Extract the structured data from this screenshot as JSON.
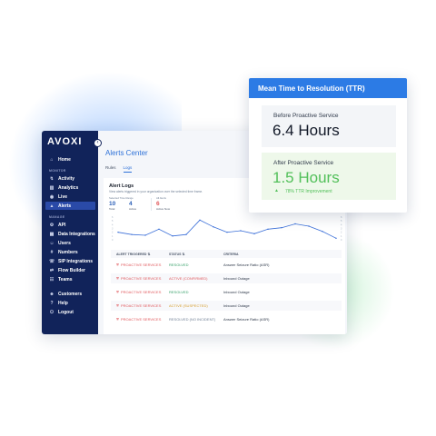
{
  "brand": {
    "logo": "AVOXI",
    "accent": "#2c7be5",
    "sidebar_bg": "#11235a"
  },
  "sidebar": {
    "items_top": [
      {
        "label": "Home",
        "icon": "home-icon",
        "glyph": "⌂"
      }
    ],
    "section_monitor": "MONITOR",
    "items_monitor": [
      {
        "label": "Activity",
        "icon": "activity-icon",
        "glyph": "↯"
      },
      {
        "label": "Analytics",
        "icon": "analytics-icon",
        "glyph": "▥"
      },
      {
        "label": "Live",
        "icon": "live-icon",
        "glyph": "◉"
      },
      {
        "label": "Alerts",
        "icon": "alert-icon",
        "glyph": "▲",
        "active": true
      }
    ],
    "section_manage": "MANAGE",
    "items_manage": [
      {
        "label": "API",
        "icon": "api-icon",
        "glyph": "⚙"
      },
      {
        "label": "Data Integrations",
        "icon": "data-integrations-icon",
        "glyph": "▦"
      },
      {
        "label": "Users",
        "icon": "users-icon",
        "glyph": "☺"
      },
      {
        "label": "Numbers",
        "icon": "numbers-icon",
        "glyph": "#"
      },
      {
        "label": "SIP Integrations",
        "icon": "sip-icon",
        "glyph": "☏"
      },
      {
        "label": "Flow Builder",
        "icon": "flow-builder-icon",
        "glyph": "⇄"
      },
      {
        "label": "Teams",
        "icon": "teams-icon",
        "glyph": "☷"
      }
    ],
    "items_bottom": [
      {
        "label": "Customers",
        "icon": "customers-icon",
        "glyph": "☻"
      },
      {
        "label": "Help",
        "icon": "help-icon",
        "glyph": "?"
      },
      {
        "label": "Logout",
        "icon": "logout-icon",
        "glyph": "⏻"
      }
    ]
  },
  "main": {
    "title": "Alerts Center",
    "tabs": [
      {
        "label": "Rules"
      },
      {
        "label": "Logs",
        "active": true
      }
    ],
    "logs": {
      "title": "Alert Logs",
      "subtitle": "View alerts triggered in your organization over the selected time frame.",
      "stats": [
        {
          "label": "Selected Time Range",
          "value": "10",
          "caption": "Total"
        },
        {
          "label": "",
          "value": "4",
          "caption": "Active"
        },
        {
          "label": "All Alerts",
          "value": "6",
          "caption": "Active Now",
          "alert": true
        }
      ],
      "chart_data": {
        "type": "line",
        "x": [
          1,
          2,
          3,
          4,
          5,
          6,
          7,
          8,
          9,
          10,
          11,
          12,
          13,
          14,
          15,
          16,
          17
        ],
        "values": [
          2.0,
          1.4,
          1.2,
          2.8,
          1.0,
          1.4,
          5.2,
          3.4,
          2.0,
          2.4,
          1.6,
          2.8,
          3.2,
          4.2,
          3.6,
          2.2,
          0.4
        ],
        "ylim": [
          0,
          6
        ],
        "color": "#3b6fd8",
        "y_ticks": [
          "0",
          "1",
          "2",
          "3",
          "4",
          "5",
          "6"
        ]
      },
      "table": {
        "headers": [
          "ALERT TRIGGERED",
          "STATUS",
          "CRITERIA"
        ],
        "rows": [
          {
            "alert": "PROACTIVE SERVICES",
            "status": "RESOLVED",
            "status_kind": "resolved",
            "criteria": "Answer Seizure Ratio (ASR)"
          },
          {
            "alert": "PROACTIVE SERVICES",
            "status": "ACTIVE (CONFIRMED)",
            "status_kind": "confirmed",
            "criteria": "Inbound Outage"
          },
          {
            "alert": "PROACTIVE SERVICES",
            "status": "RESOLVED",
            "status_kind": "resolved",
            "criteria": "Inbound Outage"
          },
          {
            "alert": "PROACTIVE SERVICES",
            "status": "ACTIVE (SUSPECTED)",
            "status_kind": "suspected",
            "criteria": "Inbound Outage"
          },
          {
            "alert": "PROACTIVE SERVICES",
            "status": "RESOLVED (NO INCIDENT)",
            "status_kind": "none",
            "criteria": "Answer Seizure Ratio (ASR)"
          }
        ]
      }
    }
  },
  "ttr": {
    "title": "Mean Time to Resolution (TTR)",
    "before_label": "Before Proactive Service",
    "before_value": "6.4 Hours",
    "after_label": "After Proactive Service",
    "after_value": "1.5 Hours",
    "improvement": "78% TTR Improvement",
    "positive_color": "#52c05a"
  }
}
